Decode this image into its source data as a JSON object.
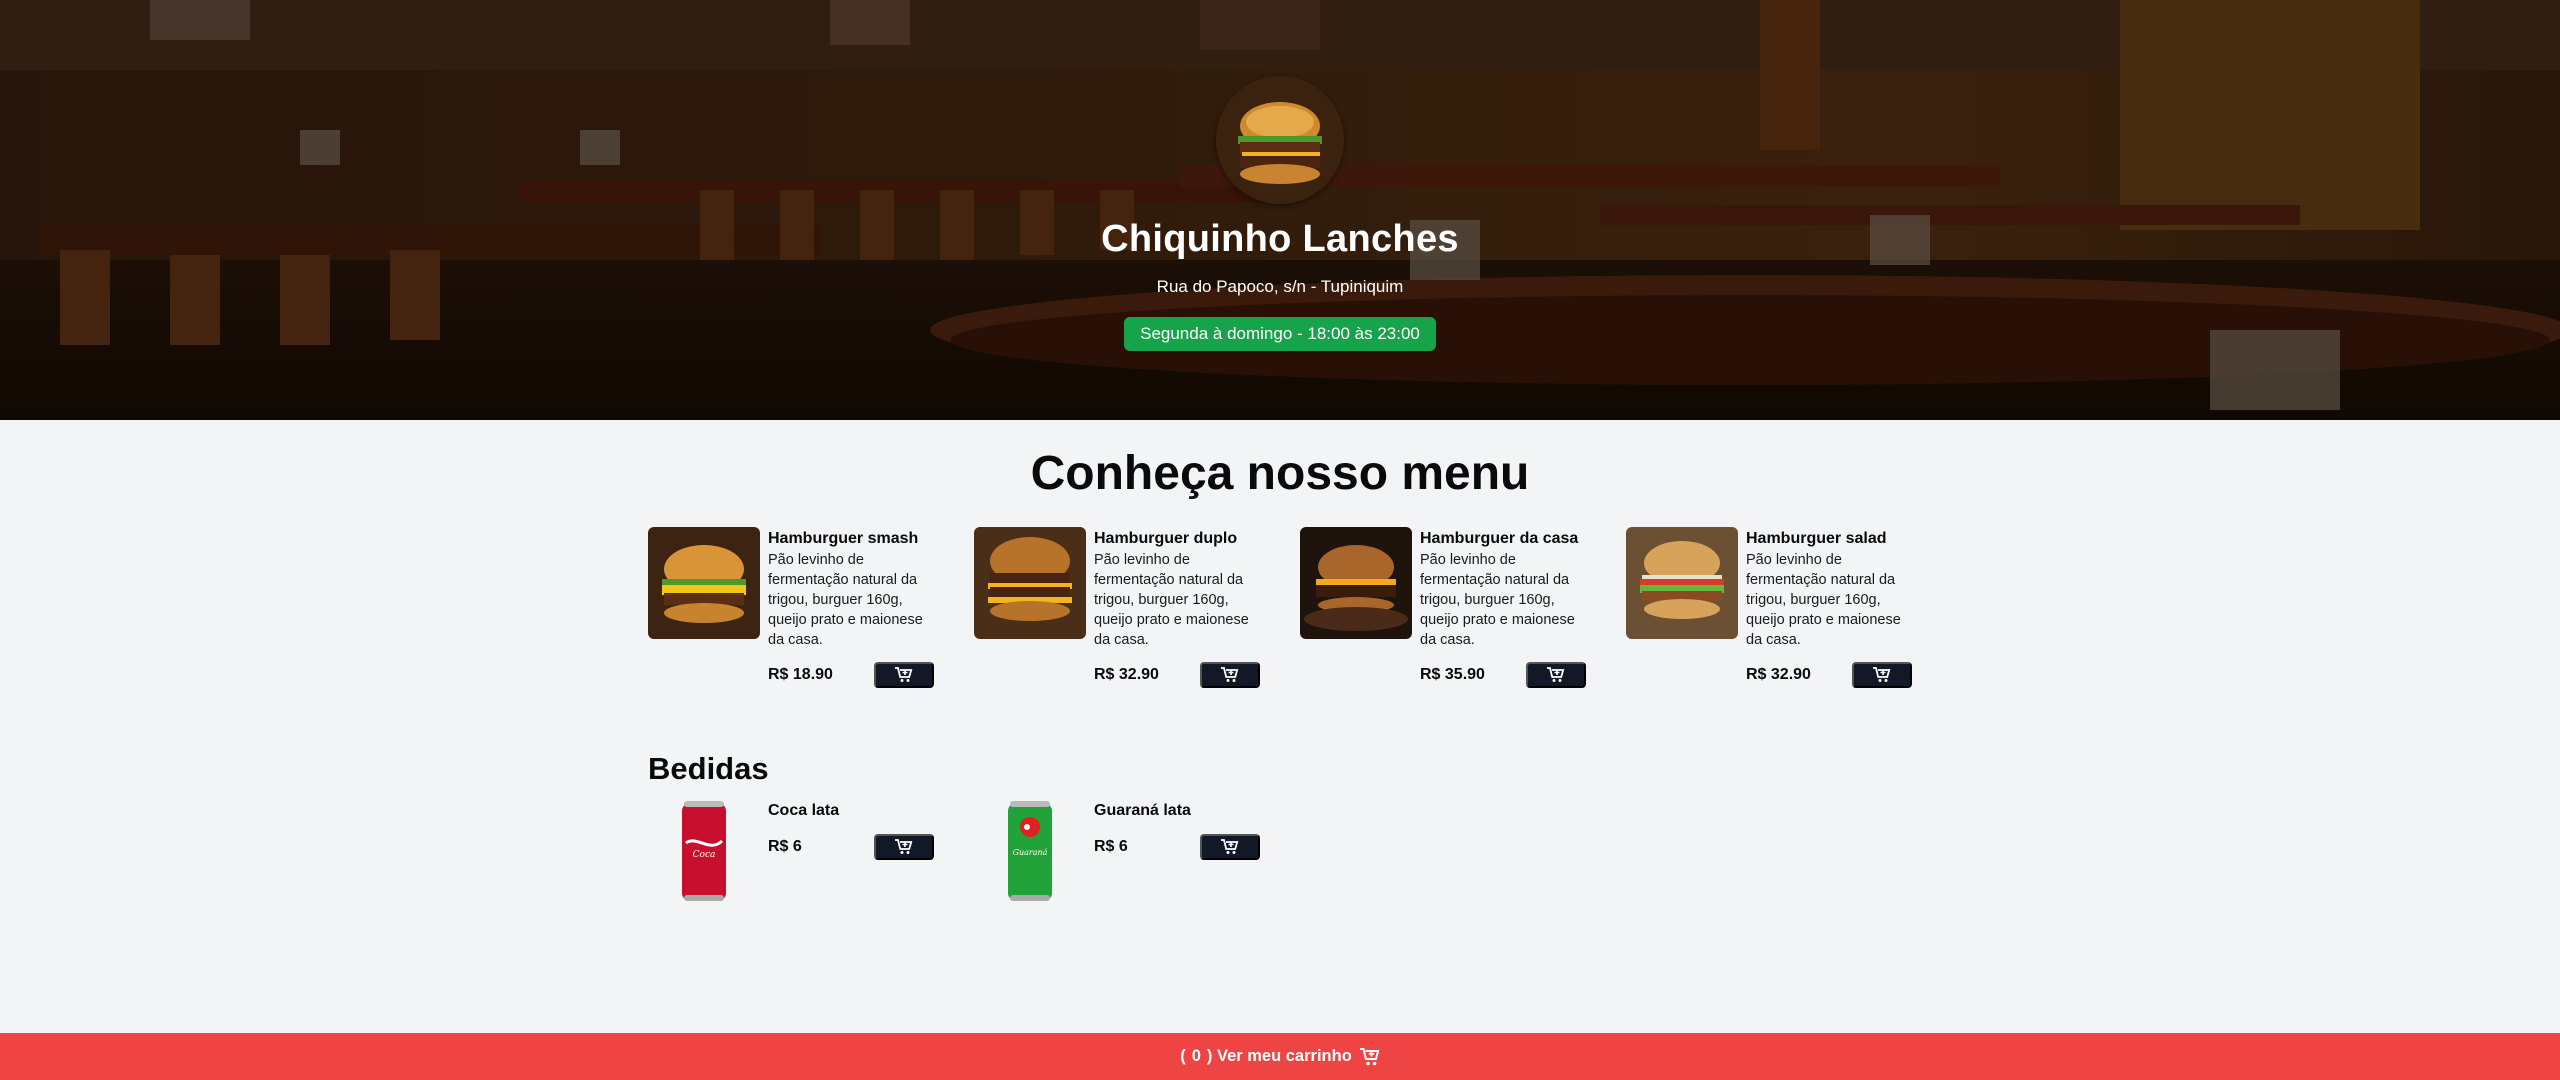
{
  "header": {
    "restaurant_name": "Chiquinho Lanches",
    "address": "Rua do Papoco, s/n - Tupiniquim",
    "hours": "Segunda à domingo - 18:00 às 23:00",
    "hours_badge_color": "#16a34a",
    "logo_icon": "burger-logo"
  },
  "menu": {
    "title": "Conheça nosso menu",
    "items": [
      {
        "name": "Hamburguer smash",
        "description": "Pão levinho de fermentação natural da trigou, burguer 160g, queijo prato e maionese da casa.",
        "price": "R$ 18.90",
        "icon": "cart-plus-icon"
      },
      {
        "name": "Hamburguer duplo",
        "description": "Pão levinho de fermentação natural da trigou, burguer 160g, queijo prato e maionese da casa.",
        "price": "R$ 32.90",
        "icon": "cart-plus-icon"
      },
      {
        "name": "Hamburguer da casa",
        "description": "Pão levinho de fermentação natural da trigou, burguer 160g, queijo prato e maionese da casa.",
        "price": "R$ 35.90",
        "icon": "cart-plus-icon"
      },
      {
        "name": "Hamburguer salad",
        "description": "Pão levinho de fermentação natural da trigou, burguer 160g, queijo prato e maionese da casa.",
        "price": "R$ 32.90",
        "icon": "cart-plus-icon"
      }
    ]
  },
  "drinks": {
    "title": "Bedidas",
    "items": [
      {
        "name": "Coca lata",
        "price": "R$ 6",
        "icon": "cart-plus-icon"
      },
      {
        "name": "Guaraná lata",
        "price": "R$ 6",
        "icon": "cart-plus-icon"
      }
    ]
  },
  "footer": {
    "open_paren": "(",
    "count": "0",
    "label": ") Ver meu carrinho",
    "icon": "cart-icon",
    "color": "#ef4444"
  },
  "colors": {
    "button_dark": "#111827",
    "background": "#f3f4f6"
  }
}
